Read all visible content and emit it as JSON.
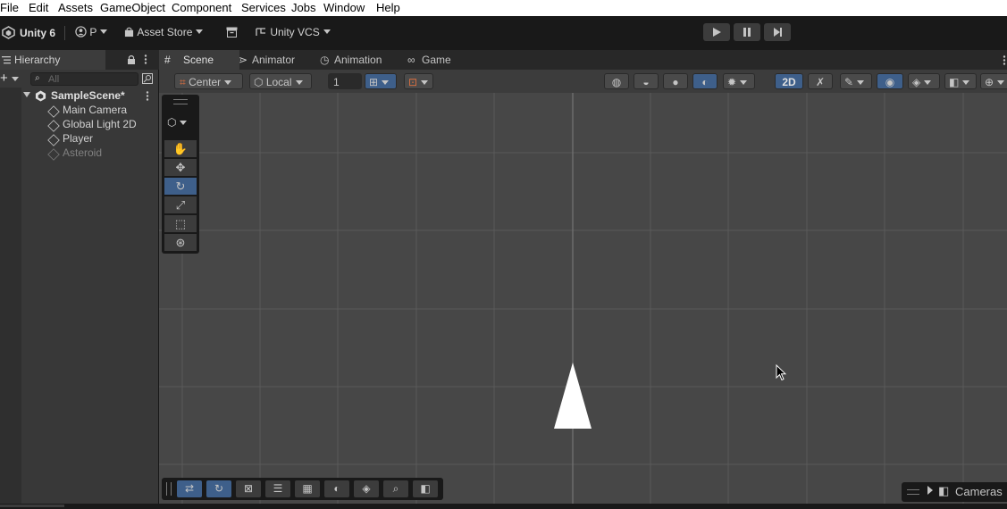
{
  "menu": [
    "File",
    "Edit",
    "Assets",
    "GameObject",
    "Component",
    "Services",
    "Jobs",
    "Window",
    "Help"
  ],
  "toolbar": {
    "app_version": "Unity 6",
    "account_initial": "P",
    "asset_store": "Asset Store",
    "vcs": "Unity VCS"
  },
  "hierarchy": {
    "tab_label": "Hierarchy",
    "search_placeholder": "All",
    "scene_name": "SampleScene*",
    "items": [
      "Main Camera",
      "Global Light 2D",
      "Player",
      "Asteroid"
    ]
  },
  "tabs": [
    {
      "label": "Scene",
      "icon": "grid-icon"
    },
    {
      "label": "Animator",
      "icon": "animator-icon"
    },
    {
      "label": "Animation",
      "icon": "clock-icon"
    },
    {
      "label": "Game",
      "icon": "gamepad-icon"
    }
  ],
  "scene_toolbar": {
    "pivot": "Center",
    "space": "Local",
    "snap_value": "1",
    "mode_2d": "2D"
  },
  "overlay": {
    "cameras_label": "Cameras"
  },
  "colors": {
    "accent": "#3e5f8a",
    "viewport": "#474747",
    "panel": "#383838",
    "toolbar": "#191919"
  }
}
